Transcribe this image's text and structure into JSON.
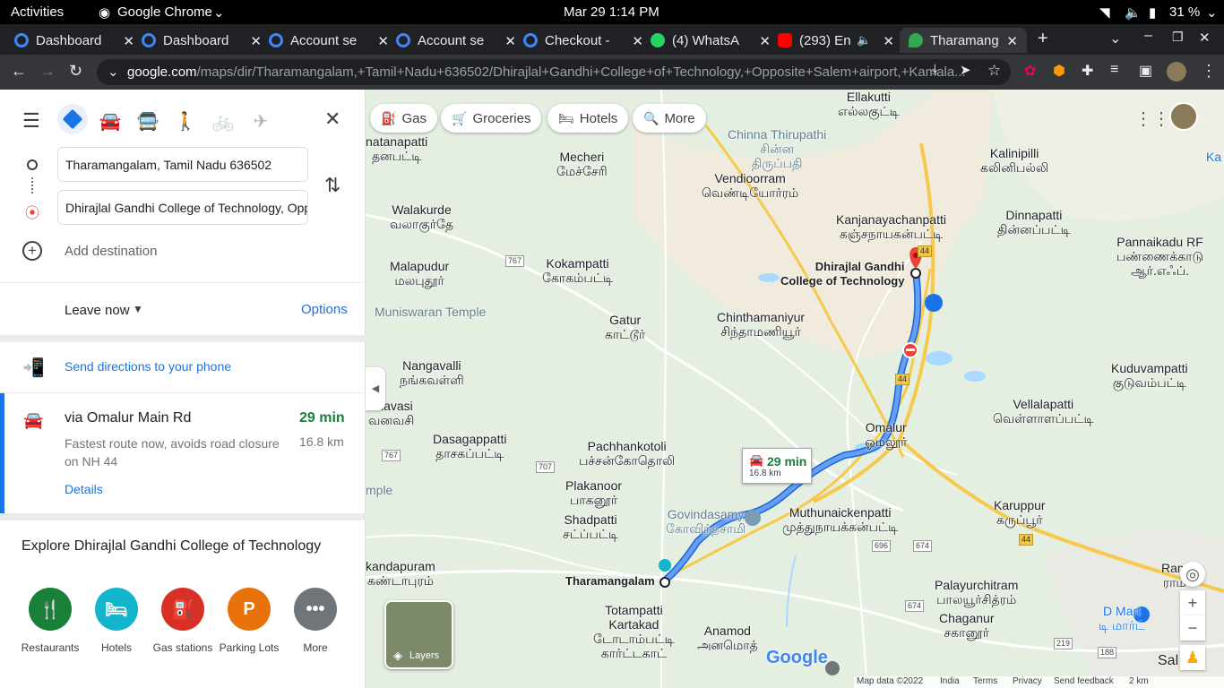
{
  "system_bar": {
    "activities": "Activities",
    "app": "Google Chrome",
    "datetime": "Mar 29  1:14 PM",
    "battery": "31 %"
  },
  "tabs": [
    {
      "title": "Dashboard",
      "color": "#4285f4"
    },
    {
      "title": "Dashboard",
      "color": "#4285f4"
    },
    {
      "title": "Account se",
      "color": "#4285f4"
    },
    {
      "title": "Account se",
      "color": "#4285f4"
    },
    {
      "title": "Checkout -",
      "color": "#4285f4"
    },
    {
      "title": "(4) WhatsA",
      "color": "#25d366"
    },
    {
      "title": "(293) En",
      "color": "#ff0000"
    },
    {
      "title": "Tharamang",
      "color": "#34a853"
    }
  ],
  "address_bar": {
    "domain": "google.com",
    "path": "/maps/dir/Tharamangalam,+Tamil+Nadu+636502/Dhirajlal+Gandhi+College+of+Technology,+Opposite+Salem+airport,+Kamala..."
  },
  "directions": {
    "origin": "Tharamangalam, Tamil Nadu 636502",
    "destination": "Dhirajlal Gandhi College of Technology, Opposite Salem airport",
    "add_destination": "Add destination",
    "leave_now": "Leave now",
    "options": "Options",
    "send_to_phone": "Send directions to your phone"
  },
  "route": {
    "via": "via Omalur Main Rd",
    "time": "29 min",
    "distance": "16.8 km",
    "note": "Fastest route now, avoids road closure on NH 44",
    "details": "Details"
  },
  "explore": {
    "title": "Explore Dhirajlal Gandhi College of Technology",
    "items": [
      {
        "label": "Restaurants",
        "color": "#188038",
        "glyph": "🍴"
      },
      {
        "label": "Hotels",
        "color": "#12b5cb",
        "glyph": "▬"
      },
      {
        "label": "Gas stations",
        "color": "#d93025",
        "glyph": "⛽"
      },
      {
        "label": "Parking Lots",
        "color": "#e8710a",
        "glyph": "P"
      },
      {
        "label": "More",
        "color": "#70757a",
        "glyph": "•••"
      }
    ]
  },
  "map_chips": [
    "Gas",
    "Groceries",
    "Hotels",
    "More"
  ],
  "map_labels": {
    "ellakutti": "Ellakutti\nஎல்லகுட்டி",
    "chinna_thirupathi": "Chinna Thirupathi\nசின்ன\nதிருப்பதி",
    "kalinipilli": "Kalinipilli\nகலினிபல்லி",
    "natanapatti": "natanapatti\nதனபட்டி",
    "mecheri": "Mecheri\nமேச்சேரி",
    "vendioorram": "Vendioorram\nவெண்டியோர்ரம்",
    "walakurde": "Walakurde\nவலாகுர்தே",
    "kanjanayachanpatti": "Kanjanayachanpatti\nகஞ்சநாயகன்பட்டி",
    "dinnapatti": "Dinnapatti\nதின்னப்பட்டி",
    "pannaikadu": "Pannaikadu RF\nபண்ணைக்காடு\nஆர்.எஃப்.",
    "malapudur": "Malapudur\nமலபுதூர்",
    "kokampatti": "Kokampatti\nகோகம்பட்டி",
    "college": "Dhirajlal Gandhi\nCollege of Technology",
    "muniswaran": "Muniswaran Temple",
    "gatur": "Gatur\nகாட்டூர்",
    "chinthamaniyur": "Chinthamaniyur\nசிந்தாமணியூர்",
    "nangavalli": "Nangavalli\nநங்கவள்ளி",
    "kuduvampatti": "Kuduvampatti\nகுடுவம்பட்டி",
    "vanavasi": "anavasi\nவனவசி",
    "vellalapatti": "Vellalapatti\nவெள்ளாளப்பட்டி",
    "omalur": "Omalur\nஓமலூர்",
    "dasagappatti": "Dasagappatti\nதாசகப்பட்டி",
    "pachhankotoli": "Pachhankotoli\nபச்சன்கோதொலி",
    "plakanoor": "Plakanoor\nபாகனூர்",
    "govindasamy": "Govindasamy\nகோவிந்தசாமி",
    "muthunaickenpatti": "Muthunaickenpatti\nமுத்துநாயக்கன்பட்டி",
    "shadpatti": "Shadpatti\nசட்ப்பட்டி",
    "karuppur": "Karuppur\nகருப்பூர்",
    "temple": "mple",
    "kandapuram": "kandapuram\nகண்டாபுரம்",
    "tharamangalam": "Tharamangalam",
    "palayurchitram": "Palayurchitram\nபாலயூர்சித்ரம்",
    "chaganur": "Chaganur\nசகானூர்",
    "totampatti": "Totampatti\nKartakad\nடோடாம்பட்டி\nகார்ட்டகாட்",
    "anamod": "Anamod\nஅனமொத்",
    "dmart": "D Mart\nடி மார்ட்",
    "ram": "Ram\nராம",
    "sal": "Sal",
    "ka": "Ka"
  },
  "route_box": {
    "time": "29 min",
    "distance": "16.8 km"
  },
  "shields": [
    "767",
    "707",
    "767",
    "696",
    "674",
    "674",
    "44",
    "44",
    "44",
    "219",
    "188",
    "44"
  ],
  "layers": "Layers",
  "google_logo": "Google",
  "footer": {
    "map_data": "Map data ©2022",
    "india": "India",
    "terms": "Terms",
    "privacy": "Privacy",
    "feedback": "Send feedback",
    "scale": "2 km"
  }
}
